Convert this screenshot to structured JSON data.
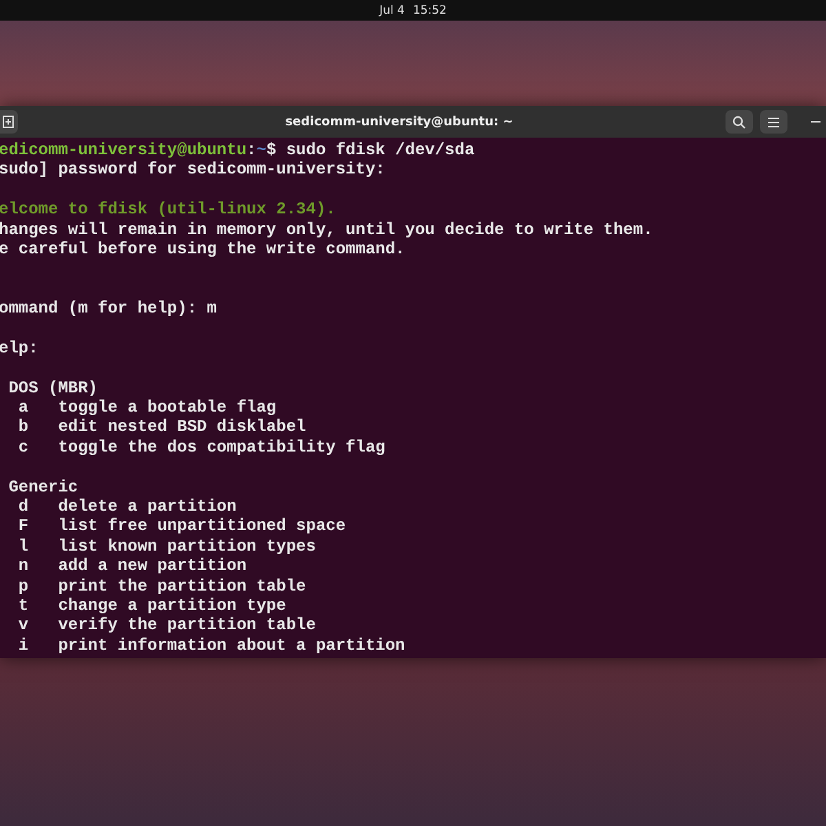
{
  "top_bar": {
    "date": "Jul 4",
    "time": "15:52"
  },
  "terminal": {
    "title": "sedicomm-university@ubuntu: ~",
    "lines": [
      {
        "kind": "prompt",
        "user": "edicomm-university@ubuntu",
        "sep": ":",
        "path": "~",
        "command": "$ sudo fdisk /dev/sda"
      },
      {
        "kind": "text",
        "text": "sudo] password for sedicomm-university:"
      },
      {
        "kind": "blank"
      },
      {
        "kind": "green",
        "text": "elcome to fdisk (util-linux 2.34)."
      },
      {
        "kind": "text",
        "text": "hanges will remain in memory only, until you decide to write them."
      },
      {
        "kind": "text",
        "text": "e careful before using the write command."
      },
      {
        "kind": "blank"
      },
      {
        "kind": "blank"
      },
      {
        "kind": "text",
        "text": "ommand (m for help): m"
      },
      {
        "kind": "blank"
      },
      {
        "kind": "text",
        "text": "elp:"
      },
      {
        "kind": "blank"
      },
      {
        "kind": "text",
        "text": " DOS (MBR)"
      },
      {
        "kind": "text",
        "text": "  a   toggle a bootable flag"
      },
      {
        "kind": "text",
        "text": "  b   edit nested BSD disklabel"
      },
      {
        "kind": "text",
        "text": "  c   toggle the dos compatibility flag"
      },
      {
        "kind": "blank"
      },
      {
        "kind": "text",
        "text": " Generic"
      },
      {
        "kind": "text",
        "text": "  d   delete a partition"
      },
      {
        "kind": "text",
        "text": "  F   list free unpartitioned space"
      },
      {
        "kind": "text",
        "text": "  l   list known partition types"
      },
      {
        "kind": "text",
        "text": "  n   add a new partition"
      },
      {
        "kind": "text",
        "text": "  p   print the partition table"
      },
      {
        "kind": "text",
        "text": "  t   change a partition type"
      },
      {
        "kind": "text",
        "text": "  v   verify the partition table"
      },
      {
        "kind": "text",
        "text": "  i   print information about a partition"
      }
    ]
  }
}
